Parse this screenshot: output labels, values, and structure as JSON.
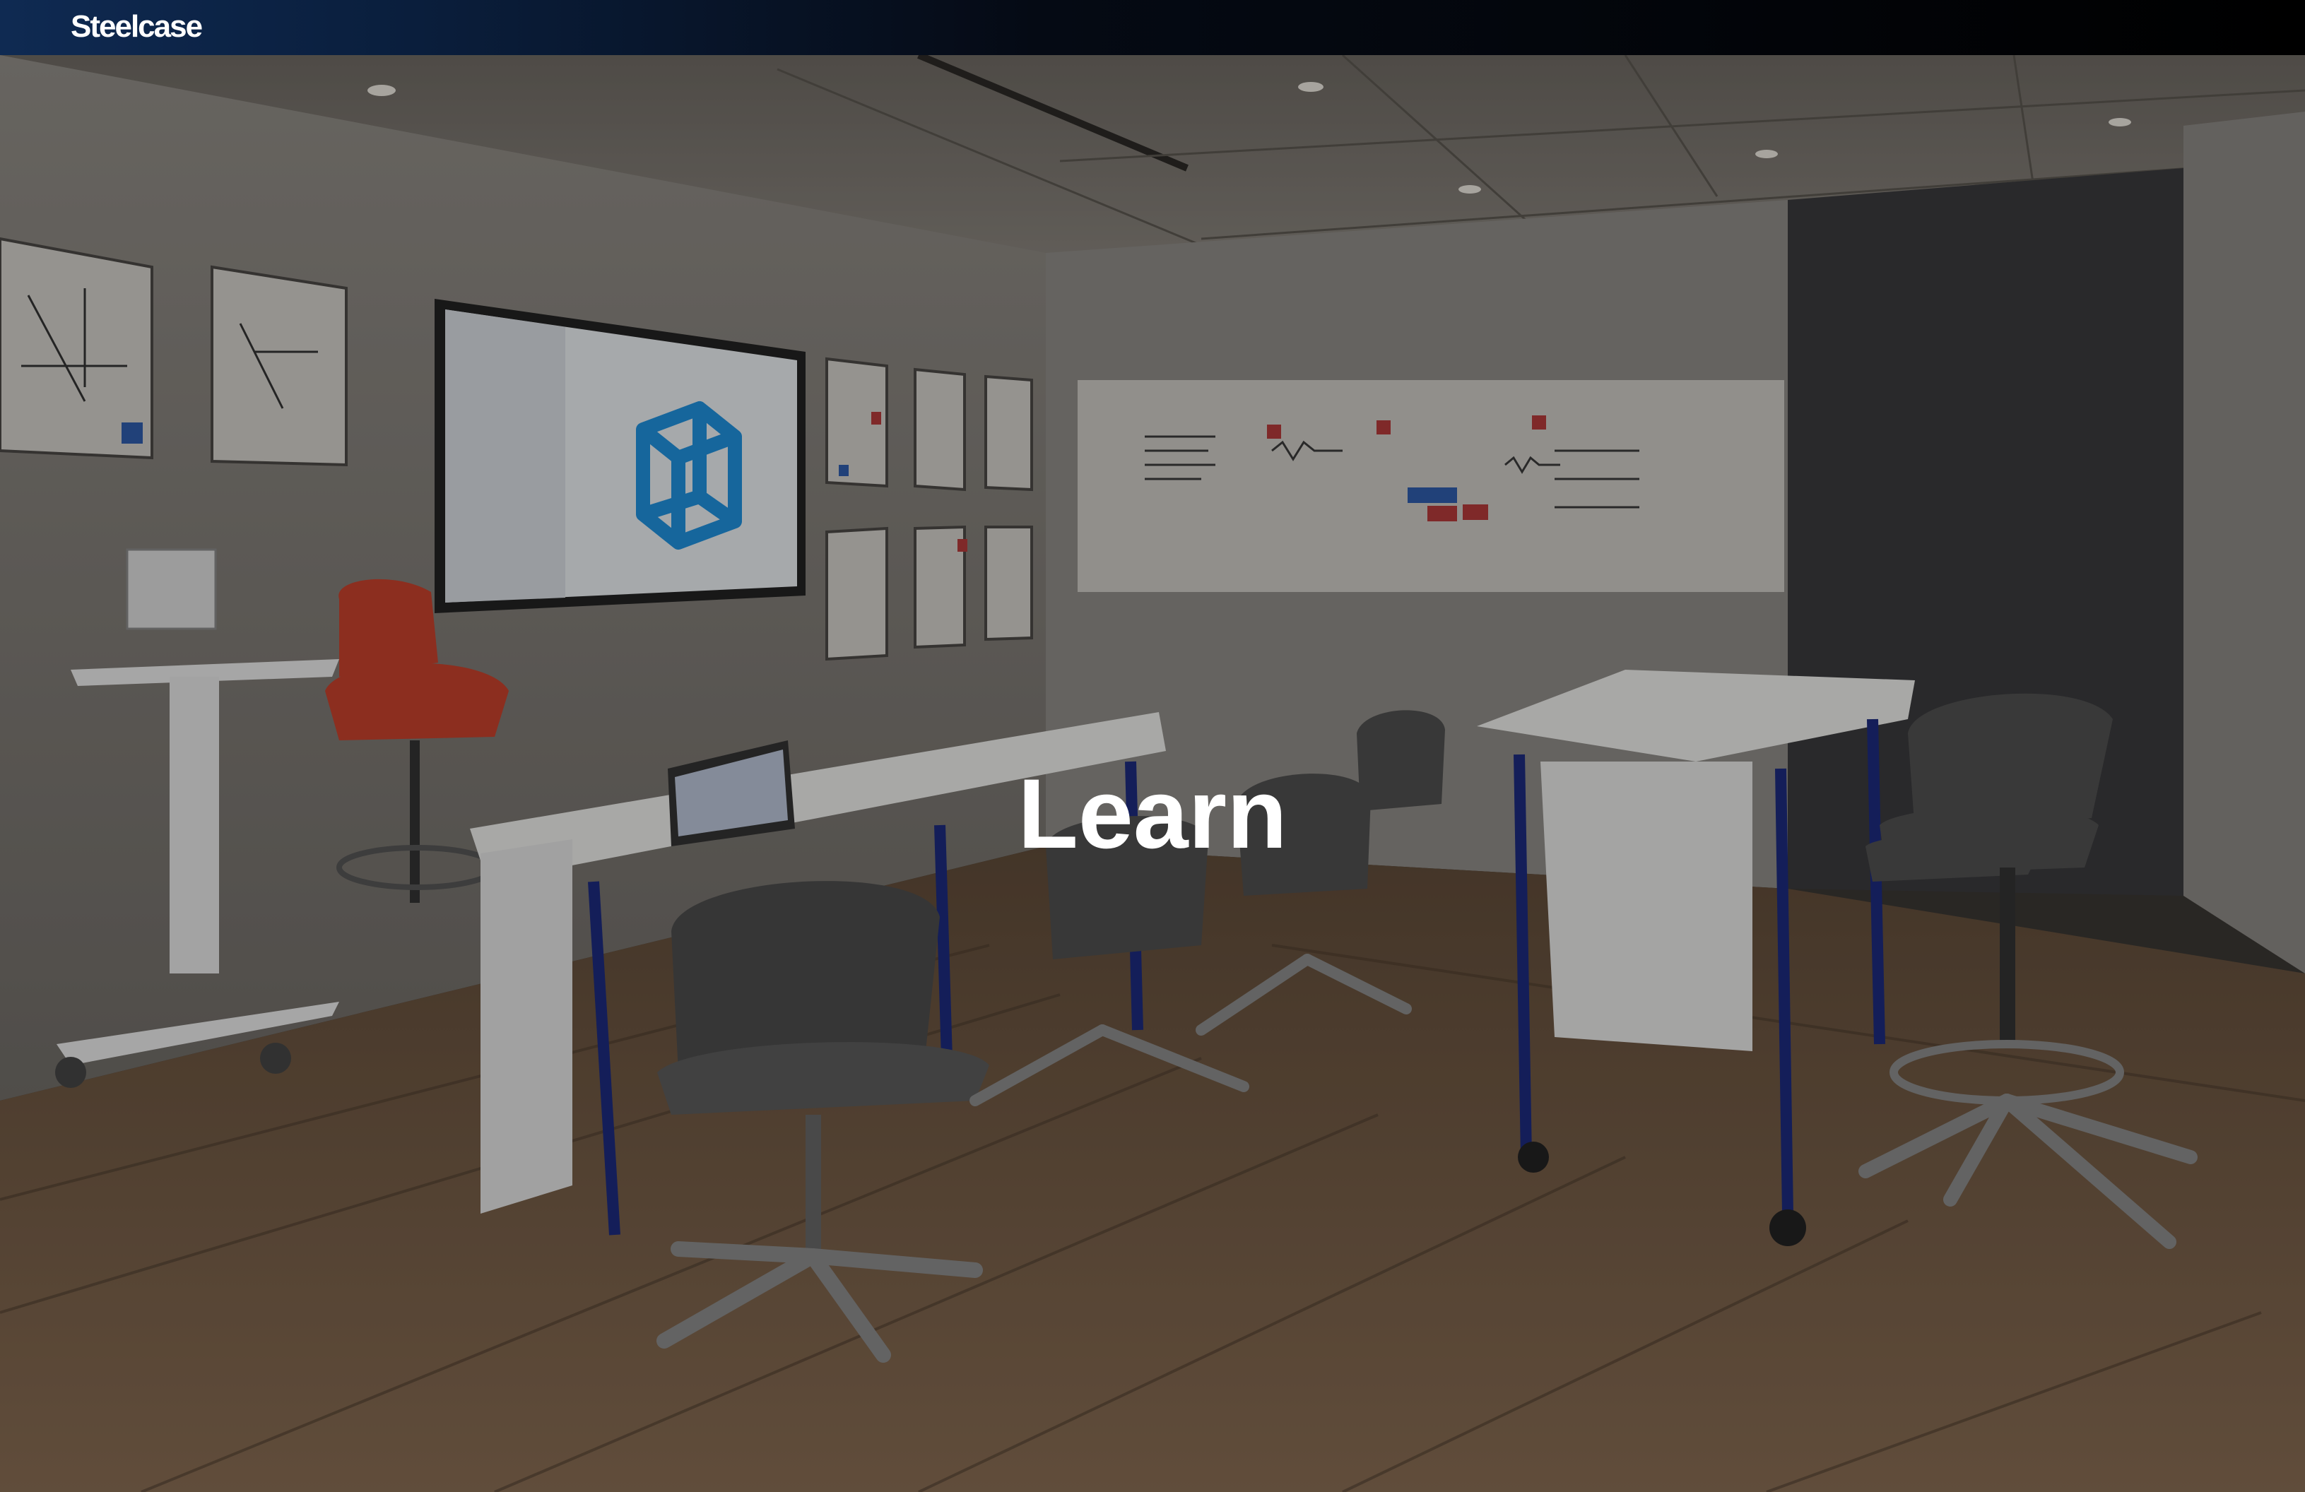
{
  "header": {
    "logo_text": "Steelcase"
  },
  "hero": {
    "title": "Learn",
    "scene": "classroom-photo"
  },
  "colors": {
    "top_bar_left": "#0f2a52",
    "top_bar_right": "#000000",
    "title_text": "#ffffff"
  }
}
